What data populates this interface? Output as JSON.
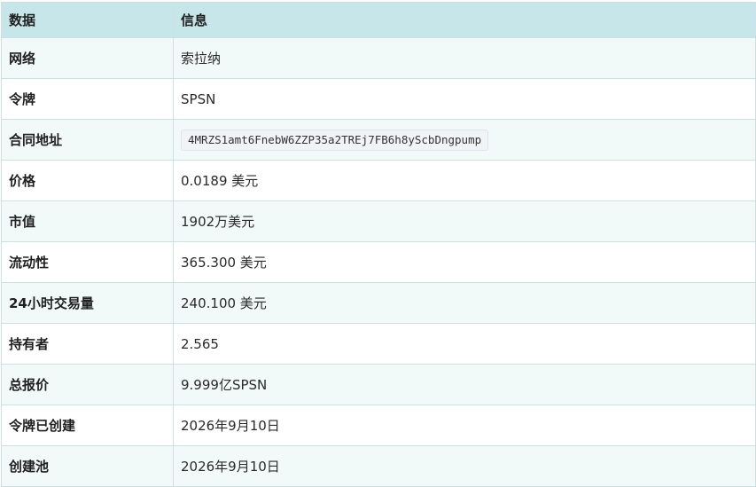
{
  "table": {
    "header": {
      "key": "数据",
      "value": "信息"
    },
    "rows": [
      {
        "key": "网络",
        "value": "索拉纳"
      },
      {
        "key": "令牌",
        "value": "SPSN"
      },
      {
        "key": "合同地址",
        "value": "4MRZS1amt6FnebW6ZZP35a2TREj7FB6h8yScbDngpump"
      },
      {
        "key": "价格",
        "value": "0.0189 美元"
      },
      {
        "key": "市值",
        "value": "1902万美元"
      },
      {
        "key": "流动性",
        "value": "365.300 美元"
      },
      {
        "key": "24小时交易量",
        "value": "240.100 美元"
      },
      {
        "key": "持有者",
        "value": "2.565"
      },
      {
        "key": "总报价",
        "value": "9.999亿SPSN"
      },
      {
        "key": "令牌已创建",
        "value": "2026年9月10日"
      },
      {
        "key": "创建池",
        "value": "2026年9月10日"
      }
    ]
  }
}
